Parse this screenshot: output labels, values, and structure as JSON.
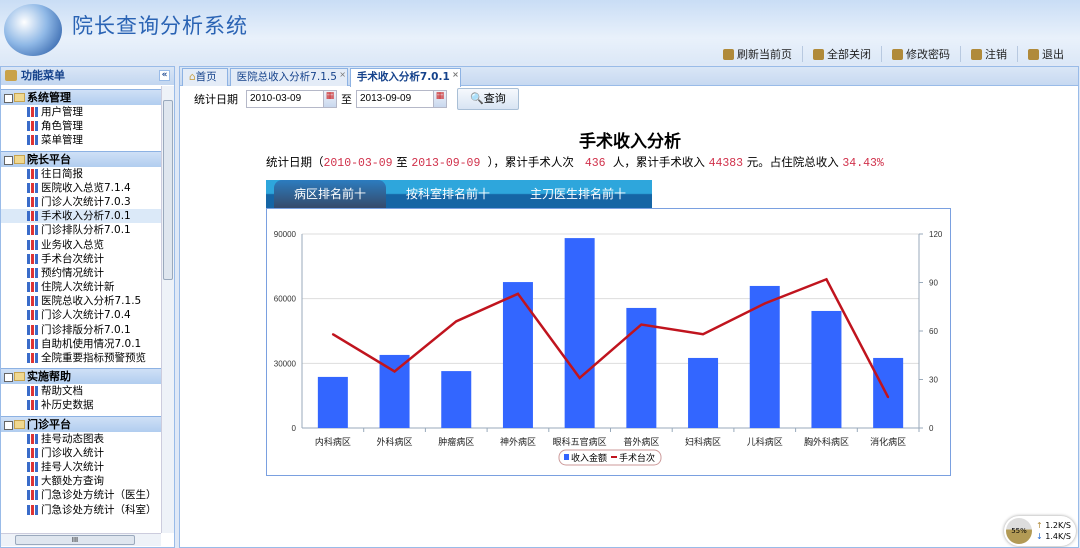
{
  "header": {
    "title": "院长查询分析系统",
    "tools": [
      {
        "icon": "refresh-icon",
        "label": "刷新当前页"
      },
      {
        "icon": "close-all-icon",
        "label": "全部关闭"
      },
      {
        "icon": "key-icon",
        "label": "修改密码"
      },
      {
        "icon": "lock-icon",
        "label": "注销"
      },
      {
        "icon": "exit-icon",
        "label": "退出"
      }
    ]
  },
  "sidebar": {
    "title": "功能菜单",
    "groups": [
      {
        "label": "系统管理",
        "items": [
          "用户管理",
          "角色管理",
          "菜单管理"
        ]
      },
      {
        "label": "院长平台",
        "items": [
          "往日简报",
          "医院收入总览7.1.4",
          "门诊人次统计7.0.3",
          "手术收入分析7.0.1",
          "门诊排队分析7.0.1",
          "业务收入总览",
          "手术台次统计",
          "预约情况统计",
          "住院人次统计新",
          "医院总收入分析7.1.5",
          "门诊人次统计7.0.4",
          "门诊排版分析7.0.1",
          "自助机使用情况7.0.1",
          "全院重要指标预警预览"
        ]
      },
      {
        "label": "实施帮助",
        "items": [
          "帮助文档",
          "补历史数据"
        ]
      },
      {
        "label": "门诊平台",
        "items": [
          "挂号动态图表",
          "门诊收入统计",
          "挂号人次统计",
          "大额处方查询",
          "门急诊处方统计（医生）",
          "门急诊处方统计（科室）"
        ]
      }
    ],
    "scroll_label": "III"
  },
  "tabs": [
    {
      "label": "首页"
    },
    {
      "label": "医院总收入分析7.1.5"
    },
    {
      "label": "手术收入分析7.0.1"
    }
  ],
  "query": {
    "label": "统计日期",
    "start": "2010-03-09",
    "to": "至",
    "end": "2013-09-09",
    "button": "查询"
  },
  "report": {
    "title": "手术收入分析",
    "s1": "统计日期（",
    "start": "2010-03-09",
    "s2": " 至 ",
    "end": "2013-09-09",
    "s3": "  ），累计手术人次   ",
    "count": "436",
    "s4": "  人，累计手术收入 ",
    "income": "44383",
    "s5": " 元。占住院总收入 ",
    "pct": "34.43%"
  },
  "chart_tabs": [
    "病区排名前十",
    "按科室排名前十",
    "主刀医生排名前十"
  ],
  "net": {
    "pct": "55%",
    "up": "1.2K/S",
    "down": "1.4K/S"
  },
  "chart_data": {
    "type": "bar",
    "categories": [
      "内科病区",
      "外科病区",
      "肿瘤病区",
      "神外病区",
      "眼科五官病区",
      "普外病区",
      "妇科病区",
      "儿科病区",
      "胸外科病区",
      "消化病区"
    ],
    "series": [
      {
        "name": "收入金额",
        "type": "bar",
        "axis": "left",
        "color": "#3366ff",
        "values": [
          23700,
          33900,
          26400,
          67700,
          88100,
          55700,
          32500,
          65900,
          54300,
          32500
        ]
      },
      {
        "name": "手术台次",
        "type": "line",
        "axis": "right",
        "color": "#c0141e",
        "values": [
          58,
          35,
          66,
          83,
          31,
          64,
          58,
          77,
          92,
          19
        ]
      }
    ],
    "ylim": [
      0,
      90000
    ],
    "yticks": [
      "0",
      "30000",
      "60000",
      "90000"
    ],
    "y2lim": [
      0,
      120
    ],
    "y2ticks": [
      "0",
      "30",
      "60",
      "90",
      "120"
    ],
    "legend": "bottom",
    "grid": true
  }
}
